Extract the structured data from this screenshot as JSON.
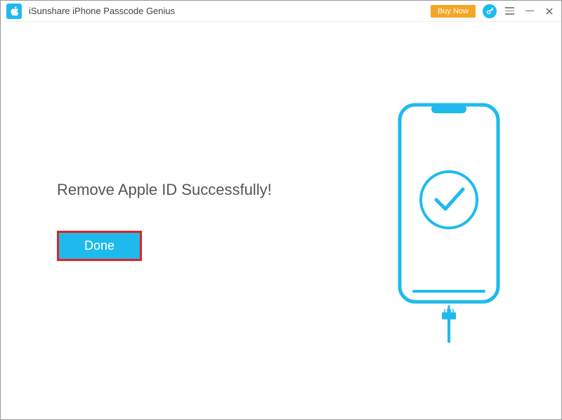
{
  "titlebar": {
    "app_title": "iSunshare iPhone Passcode Genius",
    "buy_now_label": "Buy Now"
  },
  "main": {
    "success_message": "Remove Apple ID Successfully!",
    "done_label": "Done"
  },
  "colors": {
    "accent": "#1fbaed",
    "highlight_border": "#e52020",
    "buy_now": "#f5a623"
  }
}
